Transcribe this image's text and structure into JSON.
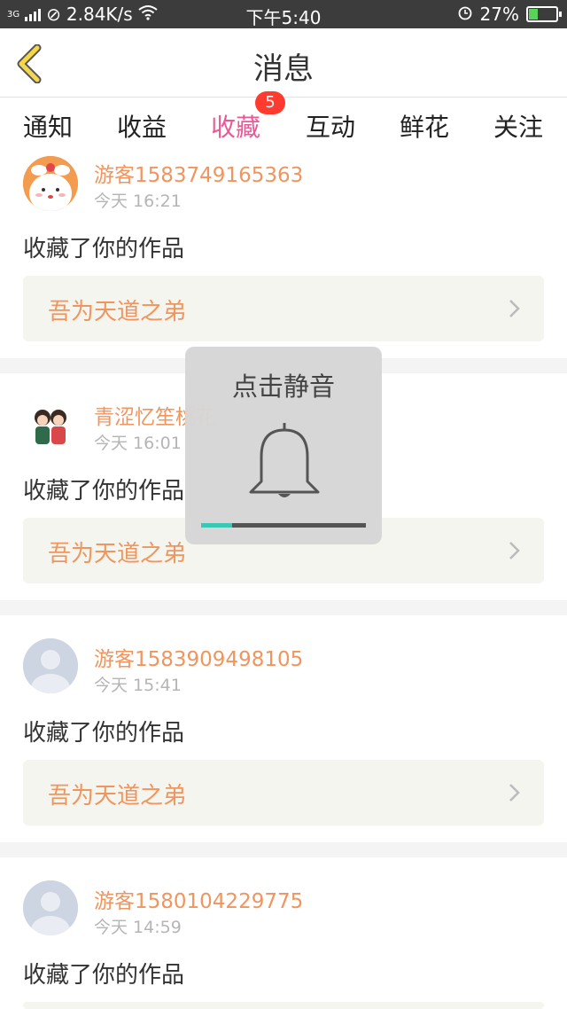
{
  "status": {
    "network": "3G",
    "speed": "2.84K/s",
    "time": "下午5:40",
    "battery": "27%"
  },
  "nav": {
    "title": "消息"
  },
  "tabs": [
    {
      "label": "通知"
    },
    {
      "label": "收益"
    },
    {
      "label": "收藏",
      "active": true,
      "badge": "5"
    },
    {
      "label": "互动"
    },
    {
      "label": "鲜花"
    },
    {
      "label": "关注"
    }
  ],
  "messages": [
    {
      "user": "游客1583749165363",
      "time": "今天 16:21",
      "action": "收藏了你的作品",
      "work": "吾为天道之弟"
    },
    {
      "user": "青涩忆笙桃花",
      "time": "今天 16:01",
      "action": "收藏了你的作品",
      "work": "吾为天道之弟"
    },
    {
      "user": "游客1583909498105",
      "time": "今天 15:41",
      "action": "收藏了你的作品",
      "work": "吾为天道之弟"
    },
    {
      "user": "游客1580104229775",
      "time": "今天 14:59",
      "action": "收藏了你的作品",
      "work": ""
    }
  ],
  "overlay": {
    "title": "点击静音",
    "volume": 0.19
  },
  "colors": {
    "accent": "#e85a95",
    "name": "#f0955e",
    "badge": "#ff3b30",
    "progress": "#3cc6b4"
  }
}
